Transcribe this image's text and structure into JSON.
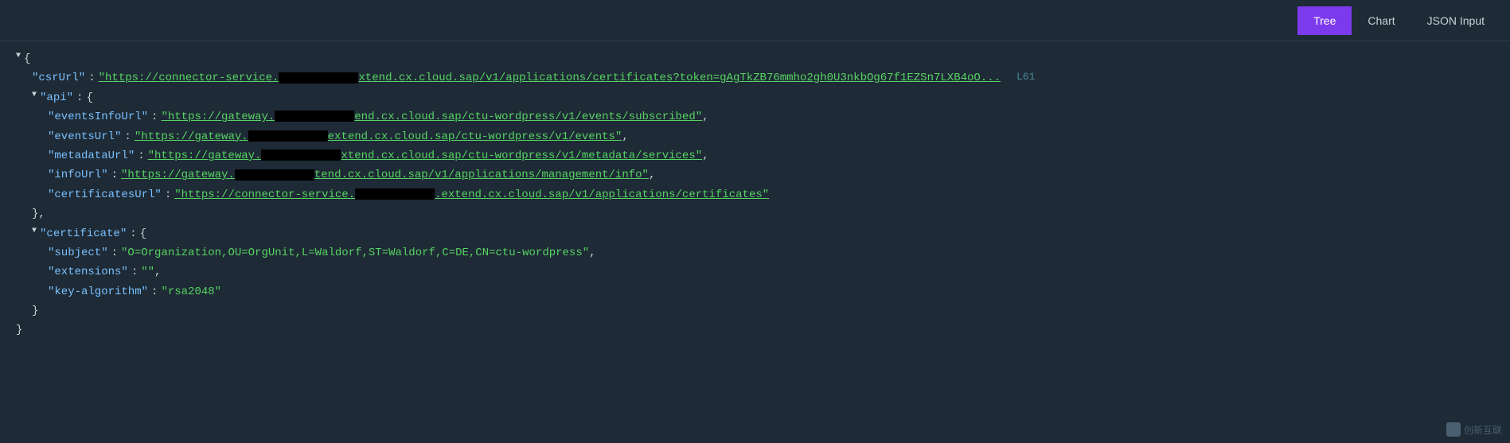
{
  "toolbar": {
    "tabs": [
      {
        "id": "tree",
        "label": "Tree",
        "active": true
      },
      {
        "id": "chart",
        "label": "Chart",
        "active": false
      },
      {
        "id": "json-input",
        "label": "JSON Input",
        "active": false
      }
    ]
  },
  "json_viewer": {
    "lines": [
      {
        "id": "root-open",
        "indent": 0,
        "content": "▼ {",
        "type": "brace"
      },
      {
        "id": "csr-url-key",
        "indent": 1,
        "key": "csrUrl",
        "type": "key-link",
        "link_start": "\"https://connector-service.",
        "redacted": true,
        "link_end": "xtend.cx.cloud.sap/v1/applications/certificates?token=gAgTkZB76mmho2gh0U3nkbOg67f1EZSn7LXB4oO...L61"
      },
      {
        "id": "api-open",
        "indent": 1,
        "content": "▼ \"api\": {",
        "type": "section"
      },
      {
        "id": "events-info-url",
        "indent": 2,
        "key": "eventsInfoUrl",
        "type": "key-link",
        "link_start": "\"https://gateway.",
        "redacted": true,
        "link_end": "end.cx.cloud.sap/ctu-wordpress/v1/events/subscribed\""
      },
      {
        "id": "events-url",
        "indent": 2,
        "key": "eventsUrl",
        "type": "key-link",
        "link_start": "\"https://gateway.",
        "redacted": true,
        "link_end": "extend.cx.cloud.sap/ctu-wordpress/v1/events\""
      },
      {
        "id": "metadata-url",
        "indent": 2,
        "key": "metadataUrl",
        "type": "key-link",
        "link_start": "\"https://gateway.",
        "redacted": true,
        "link_end": "xtend.cx.cloud.sap/ctu-wordpress/v1/metadata/services\""
      },
      {
        "id": "info-url",
        "indent": 2,
        "key": "infoUrl",
        "type": "key-link",
        "link_start": "\"https://gateway.",
        "redacted": true,
        "link_end": "tend.cx.cloud.sap/v1/applications/management/info\""
      },
      {
        "id": "certificates-url",
        "indent": 2,
        "key": "certificatesUrl",
        "type": "key-link",
        "link_start": "\"https://connector-service.",
        "redacted": true,
        "link_end": ".extend.cx.cloud.sap/v1/applications/certificates\""
      },
      {
        "id": "api-close",
        "indent": 1,
        "content": "},",
        "type": "brace"
      },
      {
        "id": "certificate-open",
        "indent": 1,
        "content": "▼ \"certificate\": {",
        "type": "section"
      },
      {
        "id": "subject",
        "indent": 2,
        "key": "subject",
        "value": "\"O=Organization,OU=OrgUnit,L=Waldorf,ST=Waldorf,C=DE,CN=ctu-wordpress\"",
        "type": "key-value"
      },
      {
        "id": "extensions",
        "indent": 2,
        "key": "extensions",
        "value": "\"\"",
        "type": "key-value"
      },
      {
        "id": "key-algorithm",
        "indent": 2,
        "key": "key-algorithm",
        "value": "\"rsa2048\"",
        "type": "key-value"
      },
      {
        "id": "certificate-close",
        "indent": 1,
        "content": "}",
        "type": "brace"
      },
      {
        "id": "root-close",
        "indent": 0,
        "content": "}",
        "type": "brace"
      }
    ]
  },
  "watermark": {
    "text": "创新互联",
    "icon": "X"
  }
}
